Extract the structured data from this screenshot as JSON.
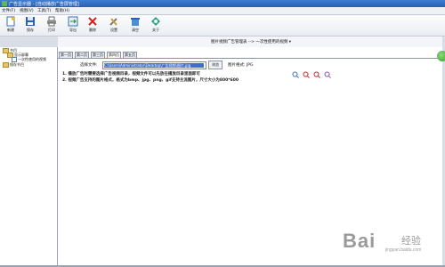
{
  "window": {
    "title": "广告显示器 - [自动播放广告屏管理]"
  },
  "menu": [
    "文件(F)",
    "视图(V)",
    "工具(T)",
    "帮助(H)"
  ],
  "toolbar": [
    {
      "label": "新建",
      "icon": "new-icon"
    },
    {
      "label": "保存",
      "icon": "save-icon"
    },
    {
      "label": "打印",
      "icon": "printer-icon"
    },
    {
      "label": "导出",
      "icon": "export-icon"
    },
    {
      "label": "删除",
      "icon": "delete-icon"
    },
    {
      "label": "设置",
      "icon": "settings-icon"
    },
    {
      "label": "清空",
      "icon": "clear-icon"
    },
    {
      "label": "关于",
      "icon": "about-icon"
    }
  ],
  "tree": {
    "root": "节目",
    "child1": "显示屏幕",
    "child2": "一次性使用的视频",
    "child3": "保存节目"
  },
  "header": {
    "title": "图片视频广告管理表 --> 一次性使用的视频 ▾"
  },
  "tabs": [
    "第一页",
    "第二页",
    "第三页",
    "第四页",
    "第五页"
  ],
  "form": {
    "file_label": "选择文件:",
    "file_value": "C:\\Users\\Administrator\\Desktop\\广告视频\\图片.jpg",
    "browse_label": "浏览",
    "format_label": "图片格式: JPG"
  },
  "tips": [
    "1. 播放广告时需要选择广告视频目录，视频文件可以先放在播放目录里面即可",
    "2. 视频广告支持的图片格式，格式为bmp、jpg、png、gif支持主流图片，尺寸大小为800*600"
  ]
}
